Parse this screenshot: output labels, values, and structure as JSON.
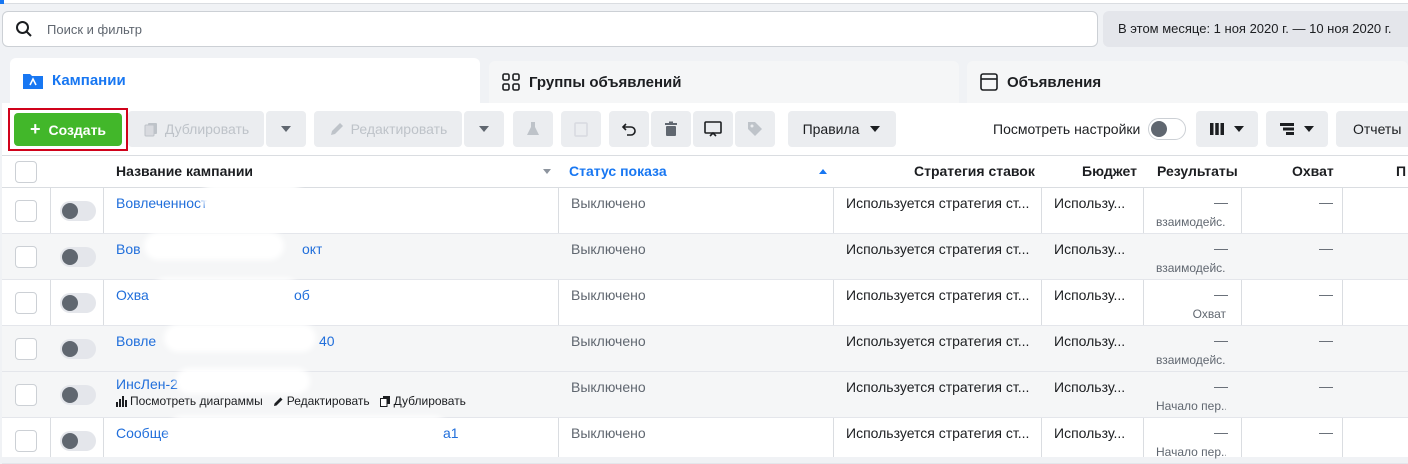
{
  "search": {
    "placeholder": "Поиск и фильтр"
  },
  "date_range": "В этом месяце: 1 ноя 2020 г. — 10 ноя 2020 г.",
  "tabs": [
    {
      "label": "Кампании",
      "active": true
    },
    {
      "label": "Группы объявлений",
      "active": false
    },
    {
      "label": "Объявления",
      "active": false
    }
  ],
  "toolbar": {
    "create_label": "Создать",
    "duplicate_label": "Дублировать",
    "edit_label": "Редактировать",
    "rules_label": "Правила",
    "settings_label": "Посмотреть настройки",
    "reports_label": "Отчеты"
  },
  "table": {
    "headers": {
      "name": "Название кампании",
      "status": "Статус показа",
      "strategy": "Стратегия ставок",
      "budget": "Бюджет",
      "results": "Результаты",
      "reach": "Охват",
      "next_partial": "П"
    },
    "rows": [
      {
        "name": "Вовлеченност",
        "name_tail": "",
        "status": "Выключено",
        "strategy": "Используется стратегия ст...",
        "budget": "Использу...",
        "result": "—",
        "result_sub": "взаимодейс...",
        "reach": "—"
      },
      {
        "name": "Вов",
        "name_tail": "окт",
        "status": "Выключено",
        "strategy": "Используется стратегия ст...",
        "budget": "Использу...",
        "result": "—",
        "result_sub": "взаимодейс...",
        "reach": "—"
      },
      {
        "name": "Охва",
        "name_tail": "об",
        "status": "Выключено",
        "strategy": "Используется стратегия ст...",
        "budget": "Использу...",
        "result": "—",
        "result_sub": "Охват",
        "reach": "—"
      },
      {
        "name": "Вовле",
        "name_tail": "40",
        "status": "Выключено",
        "strategy": "Используется стратегия ст...",
        "budget": "Использу...",
        "result": "—",
        "result_sub": "взаимодейс...",
        "reach": "—"
      },
      {
        "name": "ИнсЛен-2",
        "name_tail": "",
        "status": "Выключено",
        "strategy": "Используется стратегия ст...",
        "budget": "Использу...",
        "result": "—",
        "result_sub": "Начало пер...",
        "reach": "—"
      },
      {
        "name": "Сообще",
        "name_tail": "а1",
        "status": "Выключено",
        "strategy": "Используется стратегия ст...",
        "budget": "Использу...",
        "result": "—",
        "result_sub": "Начало пер...",
        "reach": "—"
      }
    ],
    "hover_actions": {
      "charts": "Посмотреть диаграммы",
      "edit": "Редактировать",
      "duplicate": "Дублировать"
    }
  },
  "colors": {
    "accent": "#1877f2",
    "create": "#42b72a",
    "highlight": "#d0021b",
    "link": "#216fdb"
  }
}
